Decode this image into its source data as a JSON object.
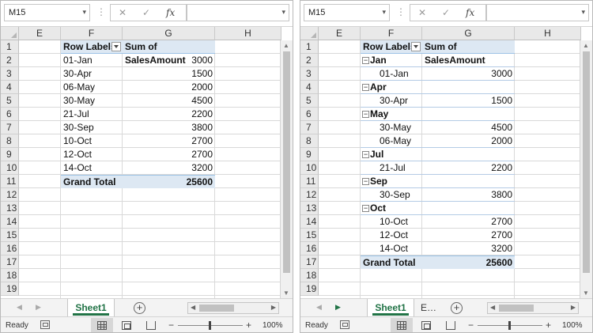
{
  "formula_bar": {
    "name_box": "M15",
    "cancel_glyph": "✕",
    "enter_glyph": "✓",
    "fx_label": "fx",
    "formula": ""
  },
  "columns": [
    "E",
    "F",
    "G",
    "H"
  ],
  "rows": [
    "1",
    "2",
    "3",
    "4",
    "5",
    "6",
    "7",
    "8",
    "9",
    "10",
    "11",
    "12",
    "13",
    "14",
    "15",
    "16",
    "17",
    "18",
    "19"
  ],
  "left_pivot": {
    "header_row_labels": "Row Labels",
    "header_values": "Sum of SalesAmount",
    "rows": [
      {
        "label": "01-Jan",
        "value": "3000"
      },
      {
        "label": "30-Apr",
        "value": "1500"
      },
      {
        "label": "06-May",
        "value": "2000"
      },
      {
        "label": "30-May",
        "value": "4500"
      },
      {
        "label": "21-Jul",
        "value": "2200"
      },
      {
        "label": "30-Sep",
        "value": "3800"
      },
      {
        "label": "10-Oct",
        "value": "2700"
      },
      {
        "label": "12-Oct",
        "value": "2700"
      },
      {
        "label": "14-Oct",
        "value": "3200"
      }
    ],
    "grand_total_label": "Grand Total",
    "grand_total_value": "25600"
  },
  "right_pivot": {
    "header_row_labels": "Row Labels",
    "header_values": "Sum of SalesAmount",
    "rows": [
      {
        "type": "group",
        "label": "Jan"
      },
      {
        "type": "item",
        "label": "01-Jan",
        "value": "3000"
      },
      {
        "type": "group",
        "label": "Apr"
      },
      {
        "type": "item",
        "label": "30-Apr",
        "value": "1500"
      },
      {
        "type": "group",
        "label": "May"
      },
      {
        "type": "item",
        "label": "30-May",
        "value": "4500"
      },
      {
        "type": "item",
        "label": "06-May",
        "value": "2000"
      },
      {
        "type": "group",
        "label": "Jul"
      },
      {
        "type": "item",
        "label": "21-Jul",
        "value": "2200"
      },
      {
        "type": "group",
        "label": "Sep"
      },
      {
        "type": "item",
        "label": "30-Sep",
        "value": "3800"
      },
      {
        "type": "group",
        "label": "Oct"
      },
      {
        "type": "item",
        "label": "10-Oct",
        "value": "2700"
      },
      {
        "type": "item",
        "label": "12-Oct",
        "value": "2700"
      },
      {
        "type": "item",
        "label": "14-Oct",
        "value": "3200"
      }
    ],
    "grand_total_label": "Grand Total",
    "grand_total_value": "25600",
    "collapse_glyph": "−"
  },
  "tabs": {
    "left_active": "Sheet1",
    "right_active": "Sheet1",
    "right_other": "E…",
    "add_glyph": "+"
  },
  "status": {
    "ready": "Ready",
    "zoom": "100%",
    "zoom_minus": "−",
    "zoom_plus": "+"
  },
  "icons": {
    "cancel": "close-icon",
    "enter": "checkmark-icon",
    "function": "function-icon",
    "add_sheet": "plus-circle-icon"
  },
  "colors": {
    "pivot_header": "#dde8f3",
    "excel_green": "#217346"
  }
}
